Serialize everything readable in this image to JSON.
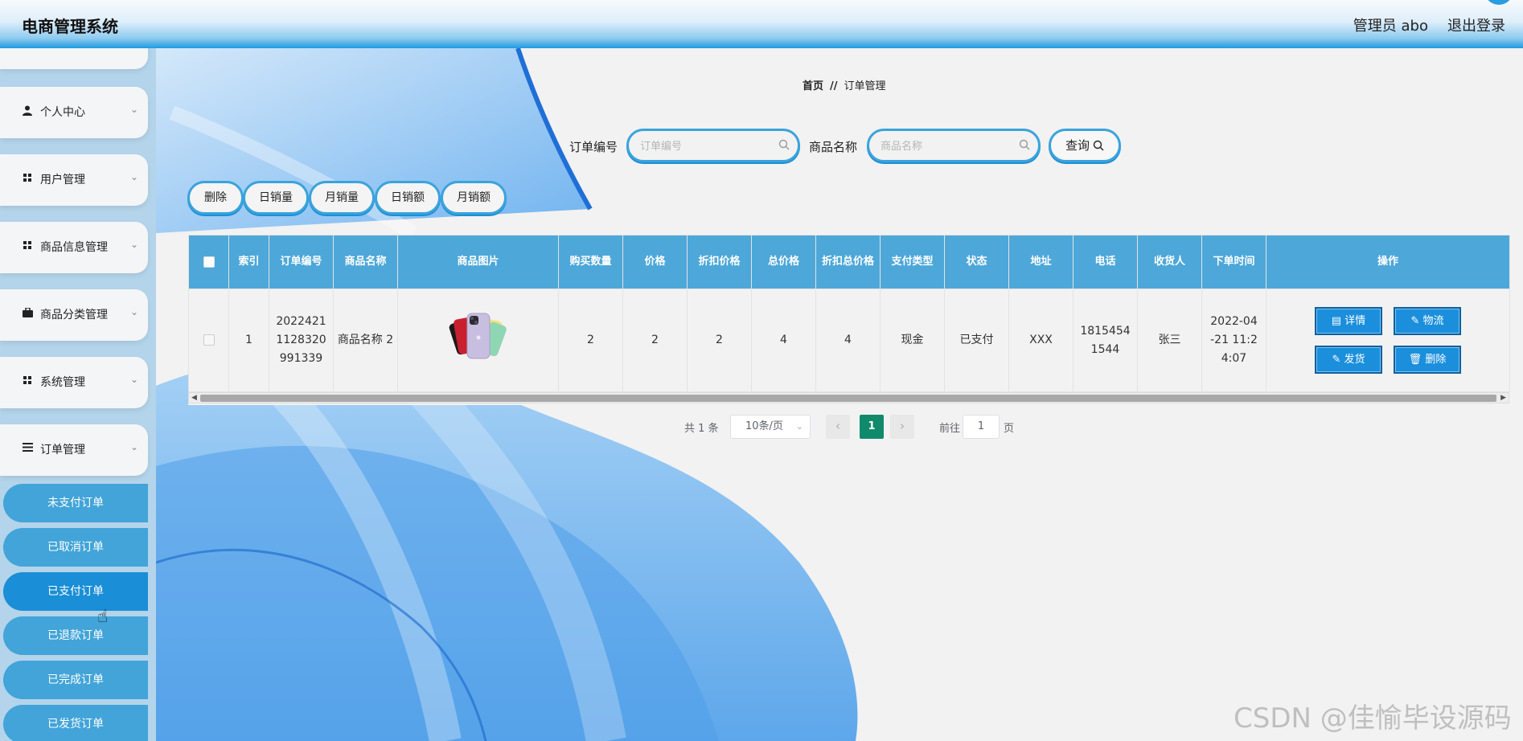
{
  "header": {
    "title": "电商管理系统",
    "admin": "管理员 abo",
    "logout": "退出登录"
  },
  "sidebar": {
    "items": [
      {
        "label": "个人中心",
        "icon": "user-icon"
      },
      {
        "label": "用户管理",
        "icon": "grid-icon"
      },
      {
        "label": "商品信息管理",
        "icon": "grid-icon"
      },
      {
        "label": "商品分类管理",
        "icon": "briefcase-icon"
      },
      {
        "label": "系统管理",
        "icon": "grid-icon"
      },
      {
        "label": "订单管理",
        "icon": "list-icon"
      }
    ],
    "sub_items": [
      "未支付订单",
      "已取消订单",
      "已支付订单",
      "已退款订单",
      "已完成订单",
      "已发货订单"
    ],
    "active_sub": "已支付订单"
  },
  "breadcrumb": {
    "home": "首页",
    "sep": "//",
    "current": "订单管理"
  },
  "search": {
    "order_no_label": "订单编号",
    "order_no_placeholder": "订单编号",
    "order_no_value": "",
    "product_label": "商品名称",
    "product_placeholder": "商品名称",
    "product_value": "",
    "query_label": "查询"
  },
  "actions": [
    "删除",
    "日销量",
    "月销量",
    "日销额",
    "月销额"
  ],
  "table": {
    "headers": [
      "索引",
      "订单编号",
      "商品名称",
      "商品图片",
      "购买数量",
      "价格",
      "折扣价格",
      "总价格",
      "折扣总价格",
      "支付类型",
      "状态",
      "地址",
      "电话",
      "收货人",
      "下单时间",
      "操作"
    ],
    "rows": [
      {
        "index": "1",
        "order_no": "2022421 1128320 991339",
        "product": "商品名称 2",
        "qty": "2",
        "price": "2",
        "discount_price": "2",
        "total": "4",
        "discount_total": "4",
        "pay_type": "现金",
        "status": "已支付",
        "address": "XXX",
        "phone": "1815454 1544",
        "receiver": "张三",
        "time": "2022-04 -21 11:2 4:07"
      }
    ],
    "ops": [
      "详情",
      "物流",
      "发货",
      "删除"
    ]
  },
  "pagination": {
    "total": "共 1 条",
    "page_size": "10条/页",
    "current": "1",
    "goto_label": "前往",
    "goto_value": "1",
    "page_suffix": "页"
  },
  "watermark": "CSDN @佳愉毕设源码",
  "colors": {
    "accent": "#1b8fdc",
    "header_blue": "#4da7d9",
    "sidebar_sub": "#42a4d8",
    "page_active": "#118a6b"
  }
}
